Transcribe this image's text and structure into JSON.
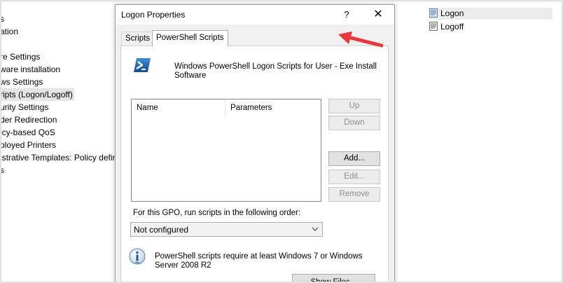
{
  "tree": {
    "items": [
      {
        "label": "s"
      },
      {
        "label": "ation"
      },
      {
        "label": "re Settings"
      },
      {
        "label": "ware installation"
      },
      {
        "label": "ws Settings"
      },
      {
        "label": "ripts (Logon/Logoff)",
        "selected": true
      },
      {
        "label": "urity Settings"
      },
      {
        "label": "der Redirection"
      },
      {
        "label": "icy-based QoS"
      },
      {
        "label": "ployed Printers"
      },
      {
        "label": "istrative Templates: Policy defin"
      },
      {
        "label": "s"
      }
    ]
  },
  "right_pane": {
    "items": [
      {
        "label": "Logon",
        "icon": "script-icon"
      },
      {
        "label": "Logoff",
        "icon": "script-icon"
      }
    ]
  },
  "dialog": {
    "title": "Logon Properties",
    "help_label": "?",
    "close_label": "✕",
    "tabs": [
      {
        "label": "Scripts"
      },
      {
        "label": "PowerShell Scripts",
        "active": true
      }
    ],
    "description": "Windows PowerShell Logon Scripts for User - Exe Install Software",
    "list": {
      "columns": [
        "Name",
        "Parameters"
      ]
    },
    "buttons": {
      "up": "Up",
      "down": "Down",
      "add": "Add...",
      "edit": "Edit...",
      "remove": "Remove",
      "show_files": "Show Files..."
    },
    "order_label": "For this GPO, run scripts in the following order:",
    "order_value": "Not configured",
    "info_text": "PowerShell scripts require at least Windows 7 or Windows Server 2008 R2"
  },
  "colors": {
    "arrow": "#e8383b",
    "powershell": "#1f6fb5"
  }
}
